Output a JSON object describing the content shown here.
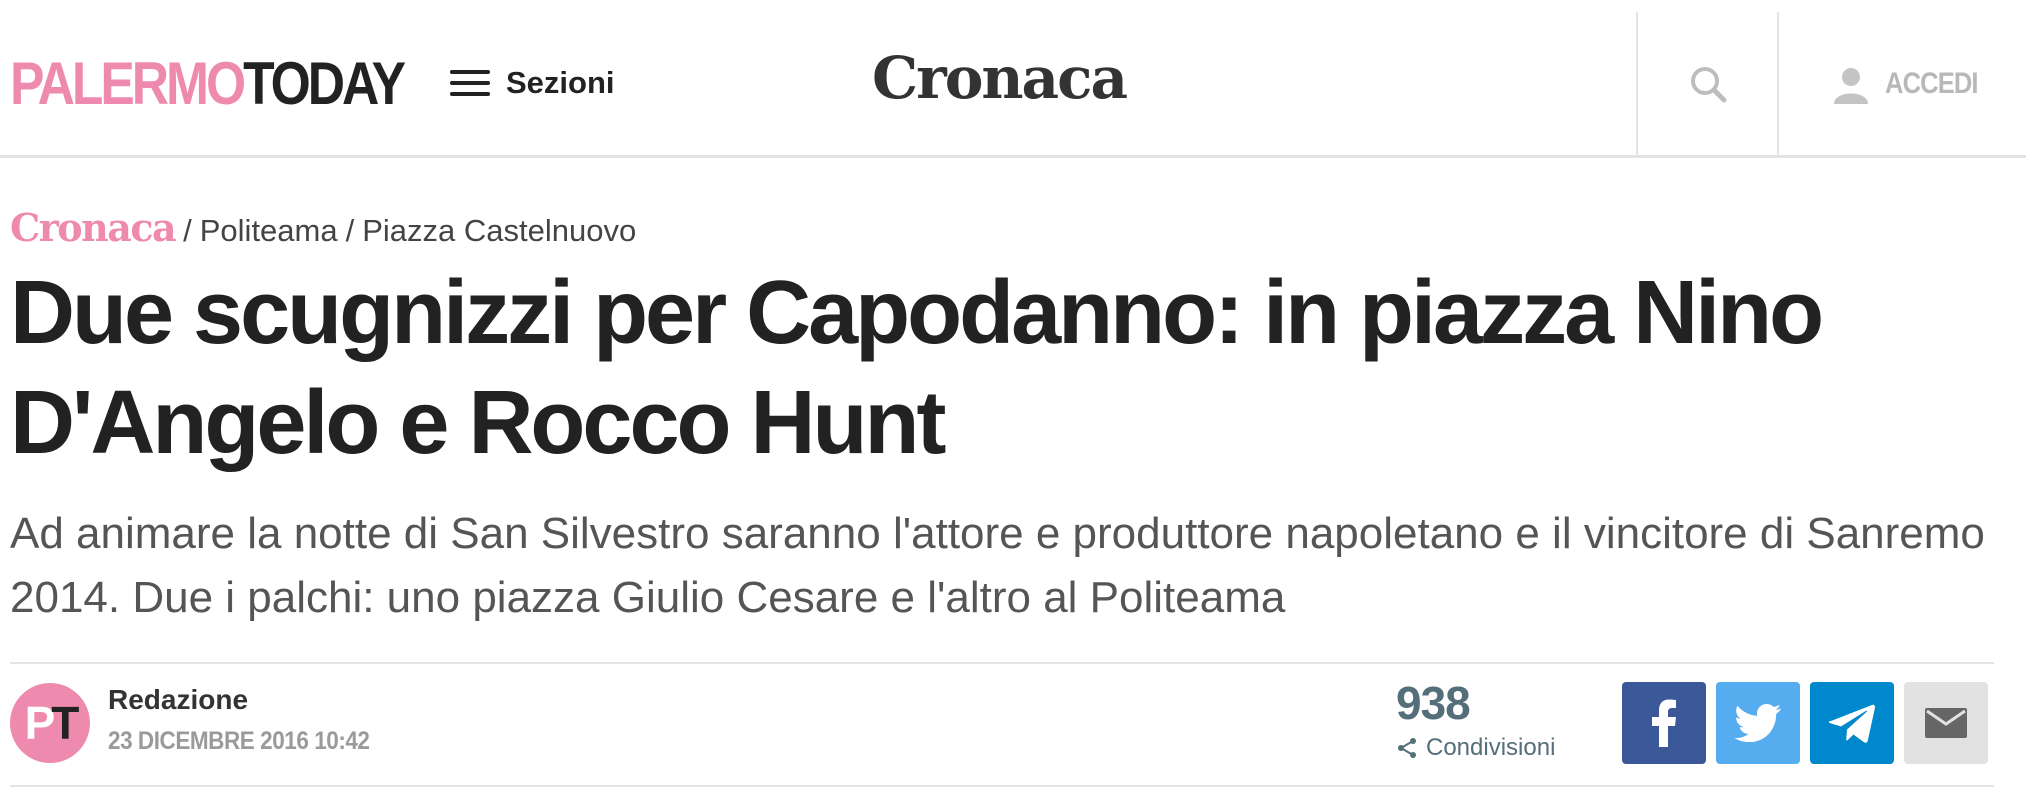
{
  "header": {
    "logo_part1": "PALERMO",
    "logo_part2": "TODAY",
    "sections_label": "Sezioni",
    "section_title": "Cronaca",
    "login_label": "ACCEDI",
    "icons": [
      "hamburger-icon",
      "search-icon",
      "user-icon"
    ]
  },
  "breadcrumb": {
    "category": "Cronaca",
    "separator": "/",
    "items": [
      "Politeama",
      "Piazza Castelnuovo"
    ]
  },
  "article": {
    "headline": "Due scugnizzi per Capodanno: in piazza Nino D'Angelo e Rocco Hunt",
    "subtitle": "Ad animare la notte di San Silvestro saranno l'attore e produttore napoletano e il vincitore di Sanremo 2014. Due i palchi: uno piazza Giulio Cesare e l'altro al Politeama"
  },
  "byline": {
    "avatar_initial1": "P",
    "avatar_initial2": "T",
    "author": "Redazione",
    "date": "23 DICEMBRE 2016 10:42"
  },
  "share": {
    "count": "938",
    "label": "Condivisioni",
    "buttons": [
      "facebook-icon",
      "twitter-icon",
      "telegram-icon",
      "email-icon"
    ]
  },
  "colors": {
    "brand_pink": "#ef8aaf",
    "text_dark": "#222222",
    "facebook": "#3b5998",
    "twitter": "#55acee",
    "telegram": "#0088cc",
    "email_bg": "#e2e2e2",
    "share_count": "#546e7a"
  }
}
